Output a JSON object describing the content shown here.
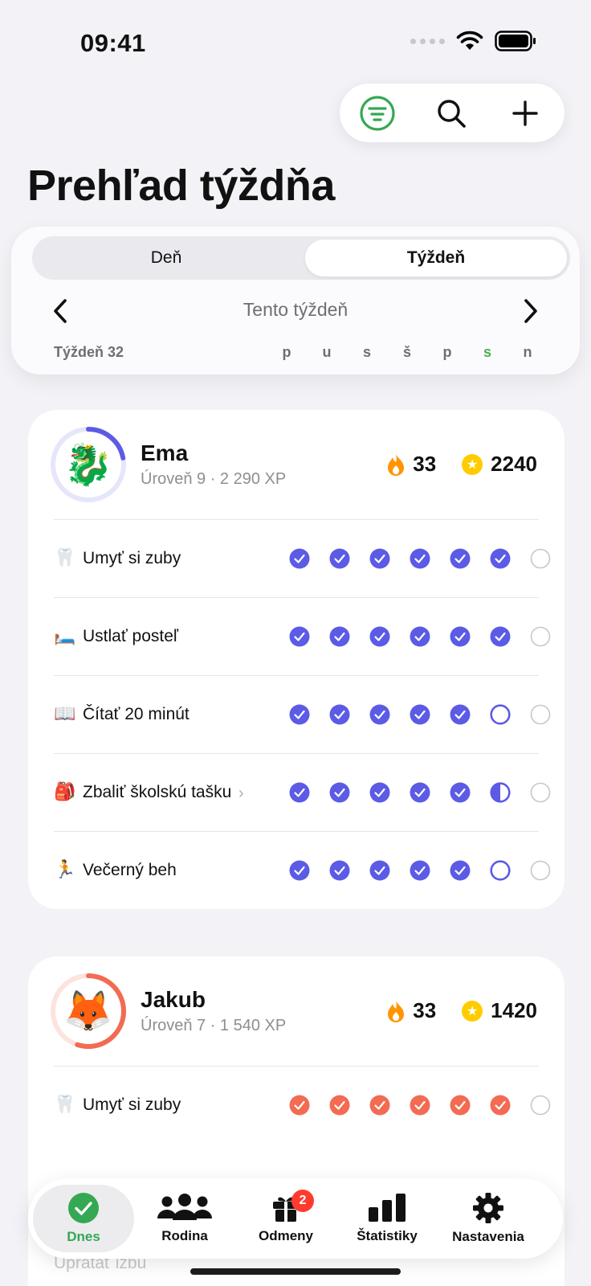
{
  "status_bar": {
    "time": "09:41"
  },
  "toolbar": {
    "filter_icon": "filter-icon",
    "search_icon": "search-icon",
    "add_icon": "plus-icon",
    "accent": "#34a853"
  },
  "page": {
    "title": "Prehľad týždňa"
  },
  "week_panel": {
    "segments": [
      "Deň",
      "Týždeň"
    ],
    "selected_segment": "Týždeň",
    "period_label": "Tento týždeň",
    "week_number": "Týždeň 32",
    "days": [
      "p",
      "u",
      "s",
      "š",
      "p",
      "s",
      "n"
    ],
    "today_index": 5
  },
  "children": [
    {
      "name": "Ema",
      "avatar": "🐉",
      "level": "Úroveň 9 · 2 290 XP",
      "level_progress": 0.22,
      "streak": "33",
      "stars": "2240",
      "color": "#5b5be6",
      "ring_bg": "#e6e6fb",
      "tasks": [
        {
          "emoji": "🦷",
          "label": "Umyť si zuby",
          "has_chevron": false,
          "status": [
            "done",
            "done",
            "done",
            "done",
            "done",
            "done",
            "none"
          ]
        },
        {
          "emoji": "🛏️",
          "label": "Ustlať posteľ",
          "has_chevron": false,
          "status": [
            "done",
            "done",
            "done",
            "done",
            "done",
            "done",
            "none"
          ]
        },
        {
          "emoji": "📖",
          "label": "Čítať 20 minút",
          "has_chevron": false,
          "status": [
            "done",
            "done",
            "done",
            "done",
            "done",
            "open",
            "none"
          ]
        },
        {
          "emoji": "🎒",
          "label": "Zbaliť školskú tašku",
          "has_chevron": true,
          "status": [
            "done",
            "done",
            "done",
            "done",
            "done",
            "half",
            "none"
          ]
        },
        {
          "emoji": "🏃",
          "label": "Večerný beh",
          "has_chevron": false,
          "status": [
            "done",
            "done",
            "done",
            "done",
            "done",
            "open",
            "none"
          ]
        }
      ]
    },
    {
      "name": "Jakub",
      "avatar": "🦊",
      "level": "Úroveň 7 · 1 540 XP",
      "level_progress": 0.55,
      "streak": "33",
      "stars": "1420",
      "color": "#f26b52",
      "ring_bg": "#fde3de",
      "tasks": [
        {
          "emoji": "🦷",
          "label": "Umyť si zuby",
          "has_chevron": false,
          "status": [
            "done",
            "done",
            "done",
            "done",
            "done",
            "done",
            "none"
          ]
        }
      ]
    }
  ],
  "peek_task": "Upratať izbu",
  "tabbar": {
    "tabs": [
      {
        "label": "Dnes",
        "icon": "check-circle-icon",
        "active": true
      },
      {
        "label": "Rodina",
        "icon": "people-icon",
        "active": false
      },
      {
        "label": "Odmeny",
        "icon": "gift-icon",
        "active": false,
        "badge": "2"
      },
      {
        "label": "Štatistiky",
        "icon": "bar-chart-icon",
        "active": false
      },
      {
        "label": "Nastavenia",
        "icon": "gear-icon",
        "active": false
      }
    ]
  }
}
